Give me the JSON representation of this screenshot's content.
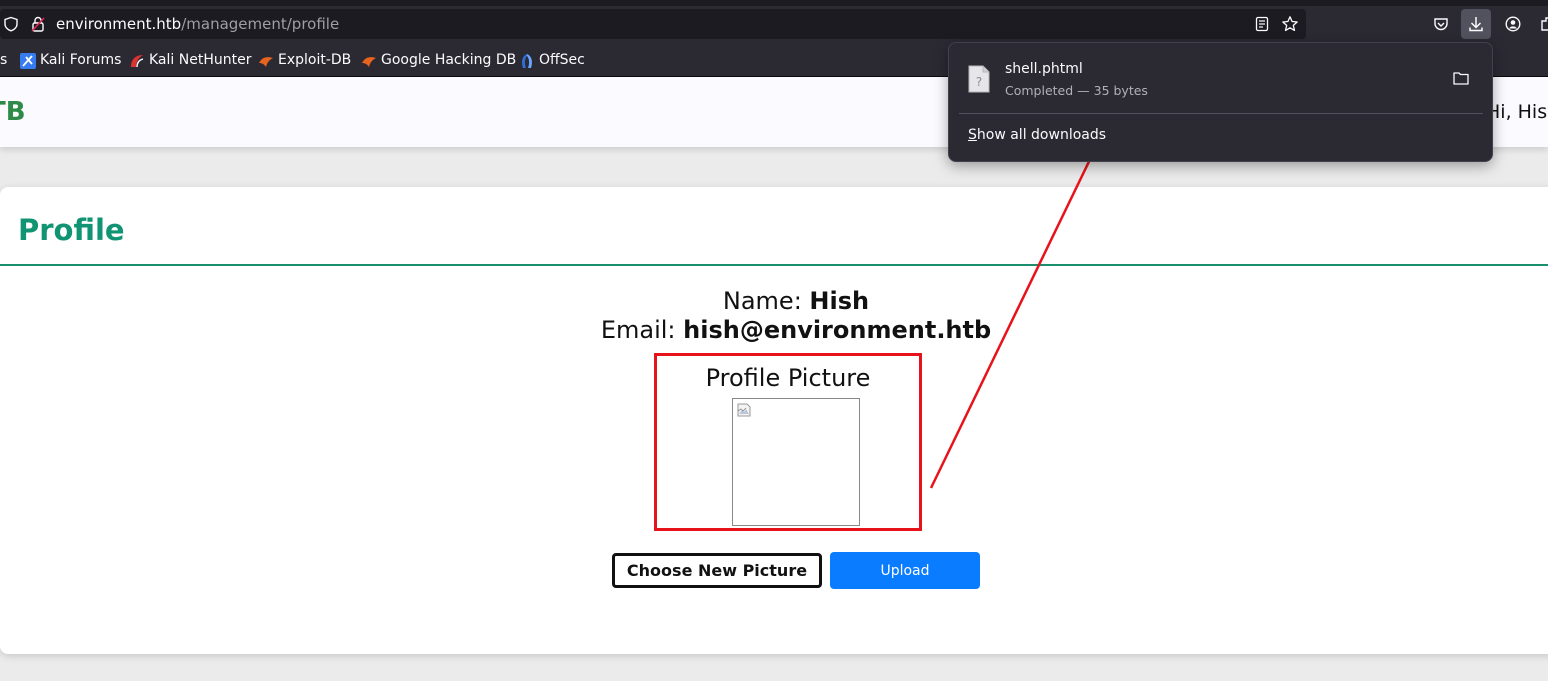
{
  "browser": {
    "url_domain": "environment.htb",
    "url_path": "/management/profile",
    "bookmarks": [
      {
        "label": "s"
      },
      {
        "label": "Kali Forums"
      },
      {
        "label": "Kali NetHunter"
      },
      {
        "label": "Exploit-DB"
      },
      {
        "label": "Google Hacking DB"
      },
      {
        "label": "OffSec"
      }
    ]
  },
  "downloads_panel": {
    "file_name": "shell.phtml",
    "status": "Completed — 35 bytes",
    "show_all_first": "S",
    "show_all_rest": "how all downloads"
  },
  "site": {
    "brand": "TB",
    "greeting": "Hi, Hish"
  },
  "profile": {
    "title": "Profile",
    "name_label": "Name:",
    "name_value": "Hish",
    "email_label": "Email:",
    "email_value": "hish@environment.htb",
    "picture_label": "Profile Picture",
    "choose_button": "Choose New Picture",
    "upload_button": "Upload"
  },
  "colors": {
    "accent_green": "#109473",
    "upload_blue": "#0a7cff",
    "annotation_red": "#e8131a",
    "chrome_bg": "#2b2a33"
  },
  "icons": [
    "shield-icon",
    "lock-icon",
    "reader-mode-icon",
    "bookmark-star-icon",
    "pocket-icon",
    "download-icon",
    "account-icon",
    "extensions-icon",
    "unknown-file-icon",
    "folder-icon",
    "broken-image-icon"
  ]
}
